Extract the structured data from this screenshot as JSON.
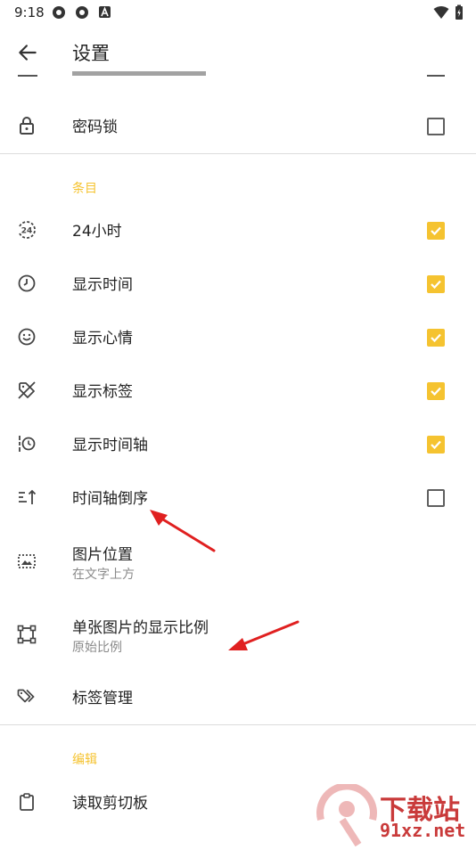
{
  "status": {
    "time": "9:18"
  },
  "appbar": {
    "title": "设置"
  },
  "rows": {
    "password_lock": {
      "label": "密码锁",
      "checked": false
    },
    "h24": {
      "label": "24小时",
      "checked": true
    },
    "show_time": {
      "label": "显示时间",
      "checked": true
    },
    "show_mood": {
      "label": "显示心情",
      "checked": true
    },
    "show_tags": {
      "label": "显示标签",
      "checked": true
    },
    "show_timeline": {
      "label": "显示时间轴",
      "checked": true
    },
    "timeline_reverse": {
      "label": "时间轴倒序",
      "checked": false
    },
    "image_position": {
      "label": "图片位置",
      "sub": "在文字上方"
    },
    "image_ratio": {
      "label": "单张图片的显示比例",
      "sub": "原始比例"
    },
    "tag_manage": {
      "label": "标签管理"
    },
    "read_clipboard": {
      "label": "读取剪切板"
    }
  },
  "sections": {
    "entries": "条目",
    "edit": "编辑"
  },
  "watermark": {
    "brand": "下载站",
    "domain": "91xz.net"
  },
  "colors": {
    "accent": "#f5c330",
    "annotation": "#e02020"
  }
}
